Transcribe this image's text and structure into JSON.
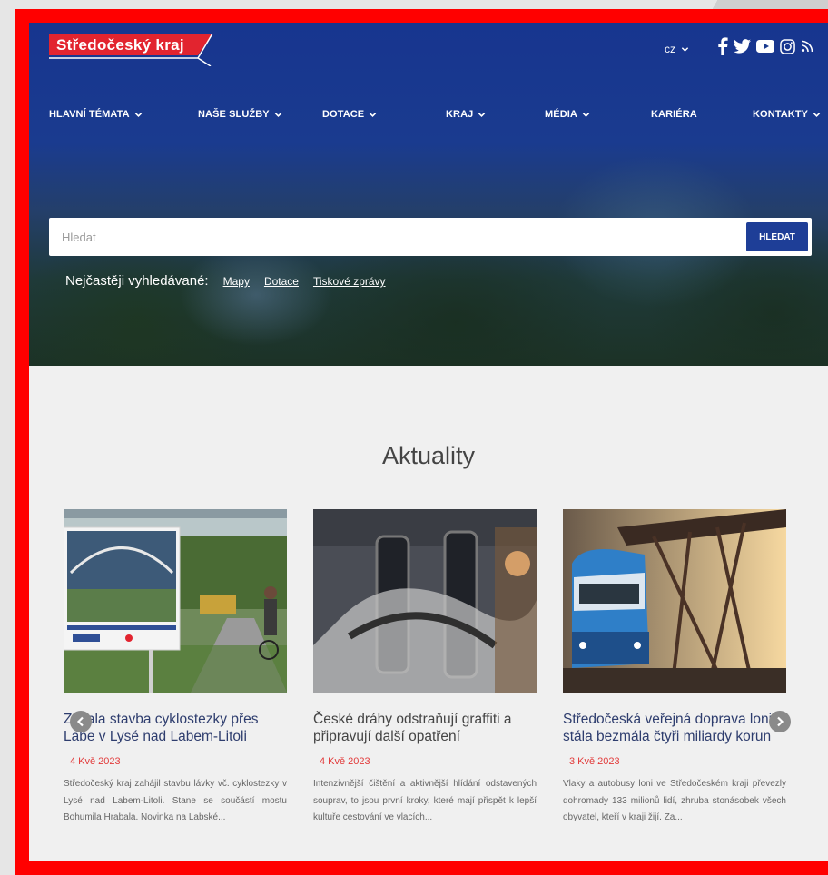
{
  "header": {
    "logo_text": "Středočeský kraj",
    "language": "cz",
    "socials": [
      "facebook",
      "twitter",
      "youtube",
      "instagram",
      "rss"
    ]
  },
  "nav": {
    "items": [
      {
        "label": "HLAVNÍ TÉMATA",
        "has_dropdown": true
      },
      {
        "label": "NAŠE SLUŽBY",
        "has_dropdown": true
      },
      {
        "label": "DOTACE",
        "has_dropdown": true
      },
      {
        "label": "KRAJ",
        "has_dropdown": true
      },
      {
        "label": "MÉDIA",
        "has_dropdown": true
      },
      {
        "label": "KARIÉRA",
        "has_dropdown": false
      },
      {
        "label": "KONTAKTY",
        "has_dropdown": true
      }
    ]
  },
  "search": {
    "placeholder": "Hledat",
    "button_label": "HLEDAT",
    "frequent_label": "Nejčastěji vyhledávané:",
    "frequent_links": [
      "Mapy",
      "Dotace",
      "Tiskové zprávy"
    ]
  },
  "news": {
    "title": "Aktuality",
    "items": [
      {
        "title": "Začala stavba cyklostezky přes Labe v Lysé nad Labem-Litoli",
        "date": "4 Kvě 2023",
        "excerpt": "Středočeský kraj zahájil stavbu lávky vč. cyklostezky v Lysé nad Labem-Litoli. Stane se součástí mostu Bohumila Hrabala. Novinka na Labské..."
      },
      {
        "title": "České dráhy odstraňují graffiti a připravují další opatření",
        "date": "4 Kvě 2023",
        "excerpt": "Intenzivnější čištění a aktivnější hlídání odstavených souprav, to jsou první kroky, které mají přispět k lepší kultuře cestování ve vlacích..."
      },
      {
        "title": "Středočeská veřejná doprava loni stála bezmála čtyři miliardy korun",
        "date": "3 Kvě 2023",
        "excerpt": "Vlaky a autobusy loni ve Středočeském kraji převezly dohromady 133 milionů lidí, zhruba stonásobek všech obyvatel, kteří v kraji žijí. Za..."
      }
    ]
  },
  "colors": {
    "brand_blue": "#1e3e97",
    "brand_red": "#e2242f",
    "date_red": "#e23b3b",
    "frame_red": "#ff0000"
  }
}
